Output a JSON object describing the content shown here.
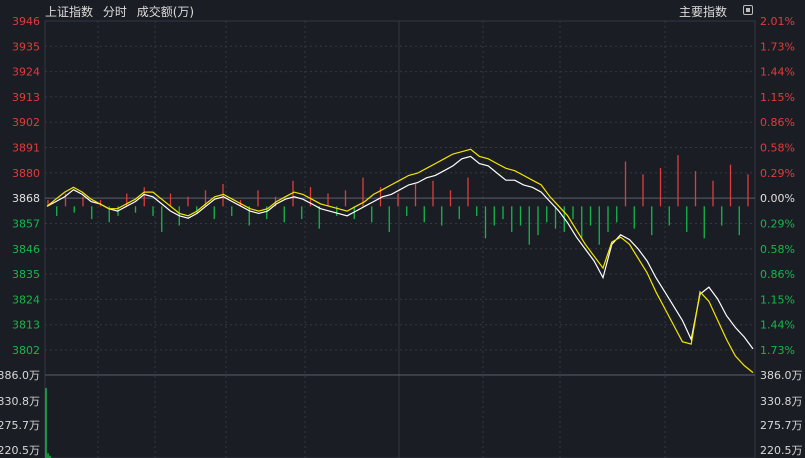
{
  "header": {
    "index_name": "上证指数",
    "mode_label": "分时",
    "volume_label": "成交额(万)",
    "main_index_label": "主要指数"
  },
  "colors": {
    "background": "#1b1d24",
    "grid": "#333842",
    "up": "#e03c3c",
    "down": "#16b74a",
    "price_line": "#ffffff",
    "avg_line": "#f2e600"
  },
  "chart_data": {
    "type": "line",
    "y_left_ticks": [
      "3946",
      "3935",
      "3924",
      "3913",
      "3902",
      "3891",
      "3880",
      "3868",
      "3857",
      "3846",
      "3835",
      "3824",
      "3813",
      "3802"
    ],
    "y_right_ticks": [
      "2.01%",
      "1.73%",
      "1.44%",
      "1.15%",
      "0.86%",
      "0.58%",
      "0.29%",
      "0.00%",
      "0.29%",
      "0.58%",
      "0.86%",
      "1.15%",
      "1.44%",
      "1.73%"
    ],
    "ylim": [
      3797,
      3946
    ],
    "prev_close": 3868,
    "volume_ticks_left": [
      "386.0万",
      "330.8万",
      "275.7万",
      "220.5万"
    ],
    "volume_ticks_right": [
      "386.0万",
      "330.8万",
      "275.7万",
      "220.5万"
    ],
    "volume_ylim": [
      220.5,
      386.0
    ],
    "volume_values": [
      360,
      230,
      225
    ],
    "series": [
      {
        "values": [
          3868,
          3870,
          3872,
          3875,
          3873,
          3870,
          3869,
          3867,
          3866,
          3868,
          3870,
          3873,
          3872,
          3869,
          3866,
          3864,
          3863,
          3865,
          3868,
          3871,
          3872,
          3870,
          3868,
          3866,
          3865,
          3866,
          3869,
          3871,
          3872,
          3871,
          3869,
          3867,
          3866,
          3865,
          3864,
          3866,
          3868,
          3870,
          3872,
          3873,
          3875,
          3877,
          3878,
          3880,
          3881,
          3883,
          3885,
          3888,
          3889,
          3886,
          3885,
          3882,
          3879,
          3879,
          3877,
          3876,
          3874,
          3870,
          3866,
          3861,
          3855,
          3850,
          3845,
          3838,
          3852,
          3856,
          3854,
          3850,
          3845,
          3838,
          3832,
          3826,
          3820,
          3812,
          3831,
          3834,
          3829,
          3822,
          3817,
          3813,
          3808
        ]
      },
      {
        "values": [
          3868,
          3871,
          3874,
          3876,
          3874,
          3871,
          3869,
          3867,
          3867,
          3869,
          3871,
          3874,
          3874,
          3871,
          3868,
          3865,
          3864,
          3866,
          3869,
          3872,
          3873,
          3871,
          3869,
          3867,
          3866,
          3867,
          3870,
          3872,
          3874,
          3873,
          3871,
          3869,
          3868,
          3867,
          3866,
          3868,
          3870,
          3873,
          3875,
          3877,
          3879,
          3881,
          3882,
          3884,
          3886,
          3888,
          3890,
          3891,
          3892,
          3889,
          3888,
          3886,
          3884,
          3883,
          3881,
          3879,
          3877,
          3872,
          3868,
          3864,
          3858,
          3852,
          3847,
          3842,
          3853,
          3855,
          3852,
          3846,
          3840,
          3832,
          3825,
          3818,
          3811,
          3810,
          3832,
          3828,
          3820,
          3812,
          3805,
          3801,
          3798
        ]
      }
    ],
    "bars": [
      2,
      -3,
      4,
      -2,
      3,
      -4,
      2,
      -5,
      -3,
      4,
      -2,
      6,
      -3,
      -8,
      4,
      -6,
      3,
      -2,
      5,
      -4,
      7,
      -3,
      2,
      -6,
      5,
      -4,
      3,
      -5,
      8,
      -4,
      6,
      -7,
      4,
      -3,
      5,
      -4,
      9,
      -5,
      6,
      -8,
      4,
      -3,
      7,
      -5,
      8,
      -6,
      5,
      -4,
      9,
      -3,
      -10,
      -6,
      -4,
      -8,
      -6,
      -12,
      -9,
      -5,
      -7,
      -8,
      -4,
      -10,
      -6,
      -12,
      -8,
      -5,
      14,
      -7,
      10,
      -9,
      12,
      -6,
      16,
      -8,
      11,
      -10,
      8,
      -6,
      13,
      -9,
      10
    ]
  }
}
